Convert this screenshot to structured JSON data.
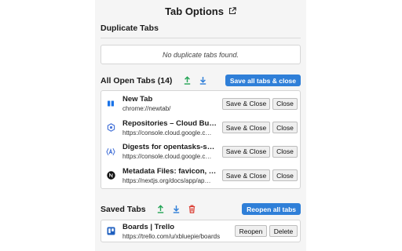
{
  "header": {
    "title": "Tab Options",
    "icon": "external-link-icon"
  },
  "duplicates": {
    "title": "Duplicate Tabs",
    "empty_text": "No duplicate tabs found."
  },
  "open_tabs": {
    "title": "All Open Tabs (14)",
    "save_all_label": "Save all tabs & close",
    "items": [
      {
        "title": "New Tab",
        "url": "chrome://newtab/",
        "icon": "chrome-newtab-icon",
        "save_label": "Save & Close",
        "close_label": "Close"
      },
      {
        "title": "Repositories – Cloud Build – …",
        "url": "https://console.cloud.google.c…",
        "icon": "cloud-build-icon",
        "save_label": "Save & Close",
        "close_label": "Close"
      },
      {
        "title": "Digests for opentasks-s…",
        "url": "https://console.cloud.google.c…",
        "icon": "artifact-registry-icon",
        "save_label": "Save & Close",
        "close_label": "Close"
      },
      {
        "title": "Metadata Files: favicon, …",
        "url": "https://nextjs.org/docs/app/ap…",
        "icon": "nextjs-icon",
        "save_label": "Save & Close",
        "close_label": "Close"
      }
    ]
  },
  "saved_tabs": {
    "title": "Saved Tabs",
    "reopen_all_label": "Reopen all tabs",
    "items": [
      {
        "title": "Boards | Trello",
        "url": "https://trello.com/u/xbluepie/boards",
        "icon": "trello-icon",
        "reopen_label": "Reopen",
        "delete_label": "Delete"
      }
    ]
  },
  "colors": {
    "accent": "#2f7fd8",
    "export": "#23a455",
    "import": "#2f7fd8",
    "delete": "#d93025"
  }
}
